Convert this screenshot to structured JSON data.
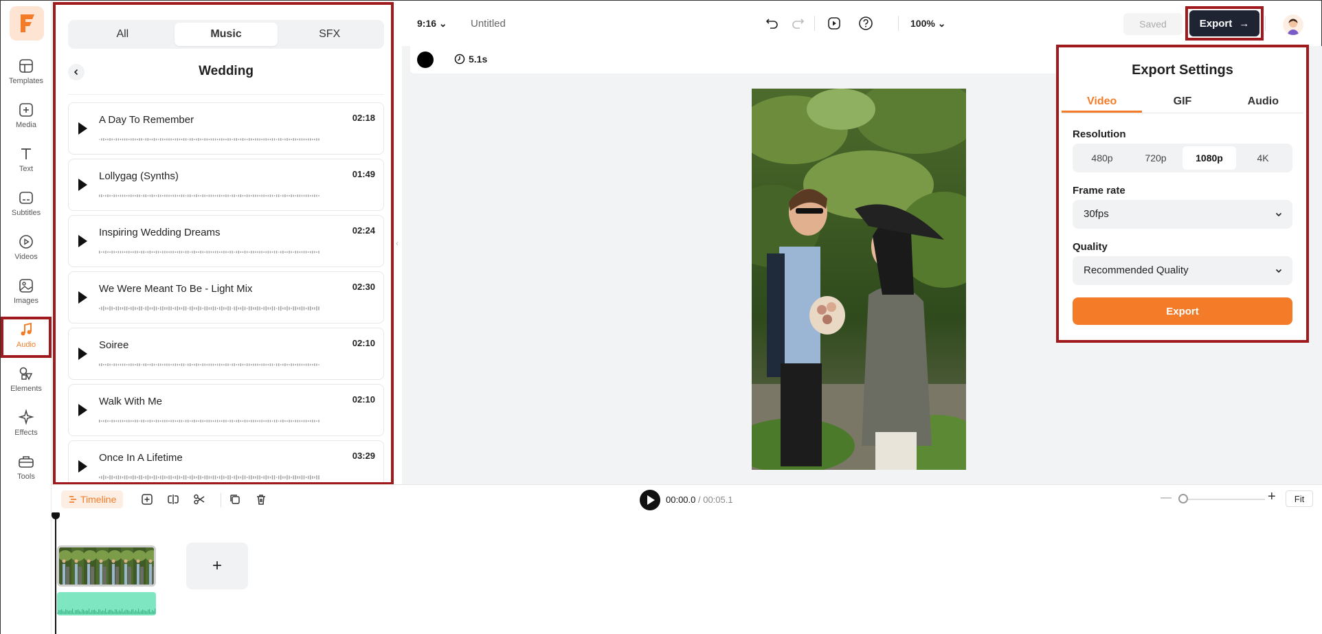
{
  "brand": {
    "logo_letter": "F",
    "accent": "#f47c29",
    "highlight": "#a0191d"
  },
  "rail": {
    "items": [
      {
        "label": "Templates",
        "icon": "templates-icon"
      },
      {
        "label": "Media",
        "icon": "media-plus-icon"
      },
      {
        "label": "Text",
        "icon": "text-icon"
      },
      {
        "label": "Subtitles",
        "icon": "subtitles-icon"
      },
      {
        "label": "Videos",
        "icon": "videos-icon"
      },
      {
        "label": "Images",
        "icon": "images-icon"
      },
      {
        "label": "Audio",
        "icon": "music-note-icon",
        "active": true
      },
      {
        "label": "Elements",
        "icon": "elements-icon"
      },
      {
        "label": "Effects",
        "icon": "effects-icon"
      },
      {
        "label": "Tools",
        "icon": "toolbox-icon"
      }
    ]
  },
  "audio_panel": {
    "tabs": [
      "All",
      "Music",
      "SFX"
    ],
    "active_tab": "Music",
    "title": "Wedding",
    "tracks": [
      {
        "name": "A Day To Remember",
        "duration": "02:18"
      },
      {
        "name": "Lollygag (Synths)",
        "duration": "01:49"
      },
      {
        "name": "Inspiring Wedding Dreams",
        "duration": "02:24"
      },
      {
        "name": "We Were Meant To Be - Light Mix",
        "duration": "02:30"
      },
      {
        "name": "Soiree",
        "duration": "02:10"
      },
      {
        "name": "Walk With Me",
        "duration": "02:10"
      },
      {
        "name": "Once In A Lifetime",
        "duration": "03:29"
      }
    ]
  },
  "topbar": {
    "aspect_ratio": "9:16",
    "project_title": "Untitled",
    "zoom": "100%",
    "saved_label": "Saved",
    "export_label": "Export"
  },
  "canvas": {
    "duration": "5.1s",
    "background_color": "#000000"
  },
  "export_settings": {
    "title": "Export Settings",
    "tabs": [
      "Video",
      "GIF",
      "Audio"
    ],
    "active_tab": "Video",
    "resolution_label": "Resolution",
    "resolutions": [
      "480p",
      "720p",
      "1080p",
      "4K"
    ],
    "selected_resolution": "1080p",
    "frame_rate_label": "Frame rate",
    "frame_rate": "30fps",
    "quality_label": "Quality",
    "quality": "Recommended Quality",
    "export_button": "Export"
  },
  "timeline": {
    "tag_label": "Timeline",
    "current_time": "00:00.0",
    "separator": " / ",
    "total_time": "00:05.1",
    "fit_label": "Fit",
    "add_clip": "+"
  }
}
